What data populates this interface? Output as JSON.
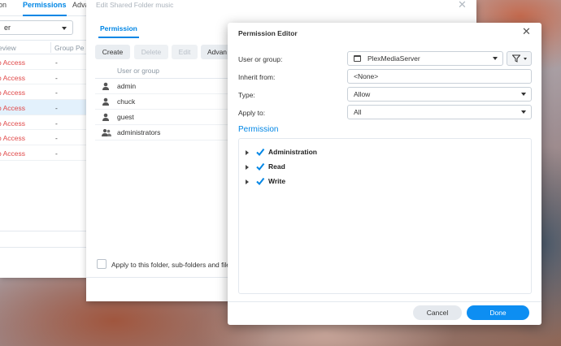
{
  "back_window": {
    "tabs": [
      {
        "label": "ion"
      },
      {
        "label": "Permissions",
        "active": true
      },
      {
        "label": "Adva"
      }
    ],
    "filter_value": "er",
    "columns": [
      "eview",
      "Group Pe"
    ],
    "rows": [
      {
        "perm": "o Access",
        "group": "-"
      },
      {
        "perm": "o Access",
        "group": "-"
      },
      {
        "perm": "o Access",
        "group": "-"
      },
      {
        "perm": "o Access",
        "group": "-",
        "selected": true
      },
      {
        "perm": "o Access",
        "group": "-"
      },
      {
        "perm": "o Access",
        "group": "-"
      },
      {
        "perm": "o Access",
        "group": "-"
      }
    ]
  },
  "edit_window": {
    "title": "Edit Shared Folder music",
    "close": "✕",
    "tab": "Permission",
    "toolbar": {
      "create": "Create",
      "delete": "Delete",
      "edit": "Edit",
      "advanced": "Advan"
    },
    "column_header": "User or group",
    "users": [
      {
        "name": "admin",
        "icon": "user-icon"
      },
      {
        "name": "chuck",
        "icon": "user-icon"
      },
      {
        "name": "guest",
        "icon": "user-icon"
      },
      {
        "name": "administrators",
        "icon": "group-icon"
      }
    ],
    "apply_label": "Apply to this folder, sub-folders and file"
  },
  "permission_editor": {
    "title": "Permission Editor",
    "close": "✕",
    "user_or_group": {
      "label": "User or group:",
      "value": "PlexMediaServer"
    },
    "inherit_from": {
      "label": "Inherit from:",
      "value": "<None>"
    },
    "type": {
      "label": "Type:",
      "value": "Allow"
    },
    "apply_to": {
      "label": "Apply to:",
      "value": "All"
    },
    "section_title": "Permission",
    "tree": [
      {
        "label": "Administration",
        "checked": true
      },
      {
        "label": "Read",
        "checked": true
      },
      {
        "label": "Write",
        "checked": true
      }
    ],
    "buttons": {
      "cancel": "Cancel",
      "done": "Done"
    },
    "accent_color": "#0086e5"
  }
}
